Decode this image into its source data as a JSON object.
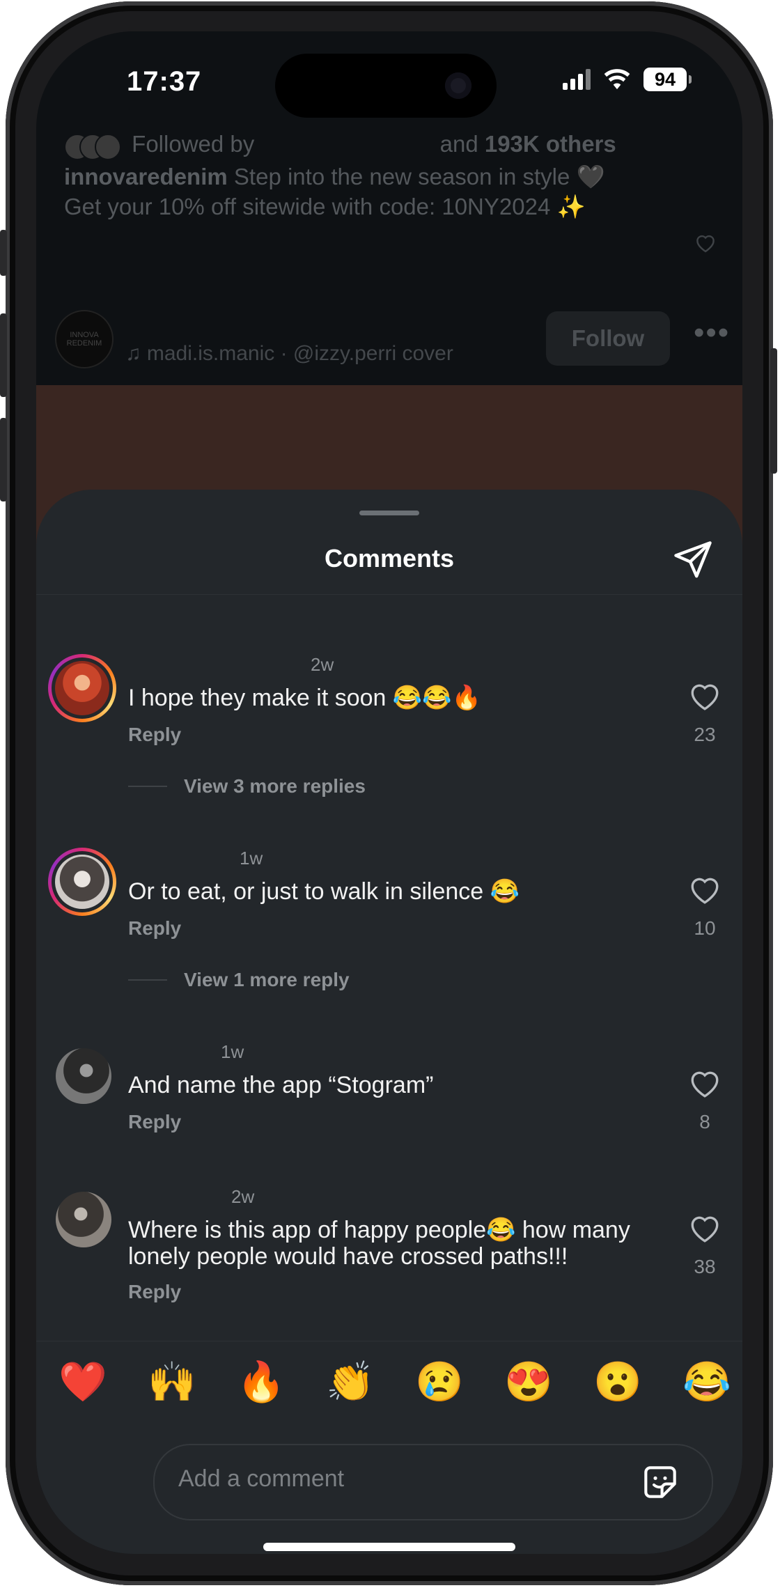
{
  "status_bar": {
    "time": "17:37",
    "battery": "94"
  },
  "post": {
    "followed_by_prefix": "Followed by",
    "followed_by_middle": "and",
    "followed_by_others": "193K others",
    "caption_user": "innovaredenim",
    "caption_line1": "Step into the new season in style 🖤",
    "caption_line2": "Get your 10% off sitewide with code: 10NY2024 ✨",
    "reel_avatar_text": "INNOVA REDENIM",
    "music_text": "madi.is.manic · @izzy.perri cover",
    "follow_label": "Follow"
  },
  "sheet": {
    "title": "Comments",
    "comments": [
      {
        "time": "2w",
        "text": "I hope they make it soon 😂😂🔥",
        "reply": "Reply",
        "likes": "23",
        "view_more": "View 3 more replies"
      },
      {
        "time": "1w",
        "text": "Or to eat, or just to walk in silence 😂",
        "reply": "Reply",
        "likes": "10",
        "view_more": "View 1 more reply"
      },
      {
        "time": "1w",
        "text": "And name the app “Stogram”",
        "reply": "Reply",
        "likes": "8"
      },
      {
        "time": "2w",
        "text": "Where is this app of happy people😂 how many lonely people would have crossed paths!!!",
        "reply": "Reply",
        "likes": "38"
      }
    ],
    "emojis": [
      "❤️",
      "🙌",
      "🔥",
      "👏",
      "😢",
      "😍",
      "😮",
      "😂"
    ],
    "comment_placeholder": "Add a comment"
  },
  "colors": {
    "sheet_bg": "#23272b",
    "ring_accent": "#d62976"
  },
  "icons": {
    "share": "paper-plane-icon",
    "like": "heart-outline-icon",
    "sticker": "sticker-icon",
    "music": "music-note-icon"
  }
}
